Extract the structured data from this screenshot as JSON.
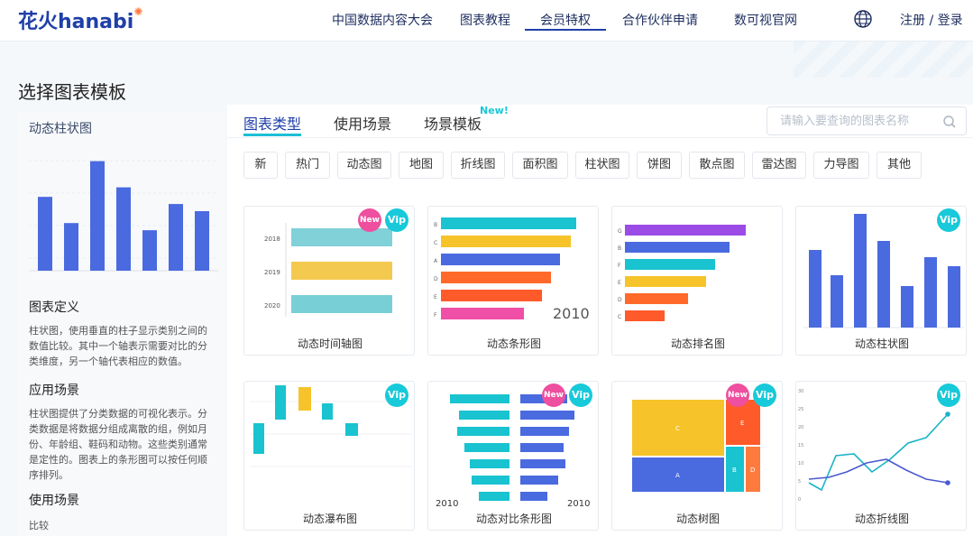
{
  "header": {
    "logo": "花火hanabi",
    "nav": [
      "中国数据内容大会",
      "图表教程",
      "会员特权",
      "合作伙伴申请",
      "数可视官网"
    ],
    "active_nav": "会员特权",
    "login": "注册 / 登录",
    "colors": {
      "brand": "#1f3fa8",
      "accent": "#18c9d9"
    }
  },
  "page": {
    "title": "选择图表模板"
  },
  "left_panel": {
    "title": "动态柱状图",
    "preview_values": [
      62,
      40,
      92,
      70,
      34,
      56,
      50
    ],
    "sections": [
      {
        "heading": "图表定义",
        "text": "柱状图，使用垂直的柱子显示类别之间的数值比较。其中一个轴表示需要对比的分类维度，另一个轴代表相应的数值。"
      },
      {
        "heading": "应用场景",
        "text": "柱状图提供了分类数据的可视化表示。分类数据是将数据分组成离散的组，例如月份、年龄组、鞋码和动物。这些类别通常是定性的。图表上的条形图可以按任何顺序排列。"
      },
      {
        "heading": "使用场景",
        "text": "比较"
      }
    ]
  },
  "tabs": [
    {
      "label": "图表类型",
      "active": true
    },
    {
      "label": "使用场景",
      "active": false
    },
    {
      "label": "场景模板",
      "active": false
    }
  ],
  "tab_badge": "New!",
  "search": {
    "placeholder": "请输入要查询的图表名称"
  },
  "filters": [
    "新",
    "热门",
    "动态图",
    "地图",
    "折线图",
    "面积图",
    "柱状图",
    "饼图",
    "散点图",
    "雷达图",
    "力导图",
    "其他"
  ],
  "cards": [
    {
      "label": "动态时间轴图",
      "vip": "Vip",
      "new": "New",
      "years": [
        "2018",
        "2019",
        "2020"
      ]
    },
    {
      "label": "动态条形图",
      "year": "2010",
      "categories": [
        "B",
        "C",
        "A",
        "D",
        "E",
        "F"
      ]
    },
    {
      "label": "动态排名图",
      "categories": [
        "G",
        "B",
        "F",
        "E",
        "D",
        "C",
        "B"
      ]
    },
    {
      "label": "动态柱状图",
      "vip": "Vip"
    },
    {
      "label": "动态瀑布图",
      "vip": "Vip"
    },
    {
      "label": "动态对比条形图",
      "vip": "Vip",
      "new": "New",
      "year_left": "2010",
      "year_right": "2010"
    },
    {
      "label": "动态树图",
      "vip": "Vip",
      "new": "New",
      "blocks": [
        "C",
        "E",
        "A",
        "B",
        "D"
      ]
    },
    {
      "label": "动态折线图",
      "vip": "Vip",
      "ticks": [
        "30",
        "25",
        "20",
        "15",
        "10",
        "5",
        "0"
      ]
    }
  ]
}
